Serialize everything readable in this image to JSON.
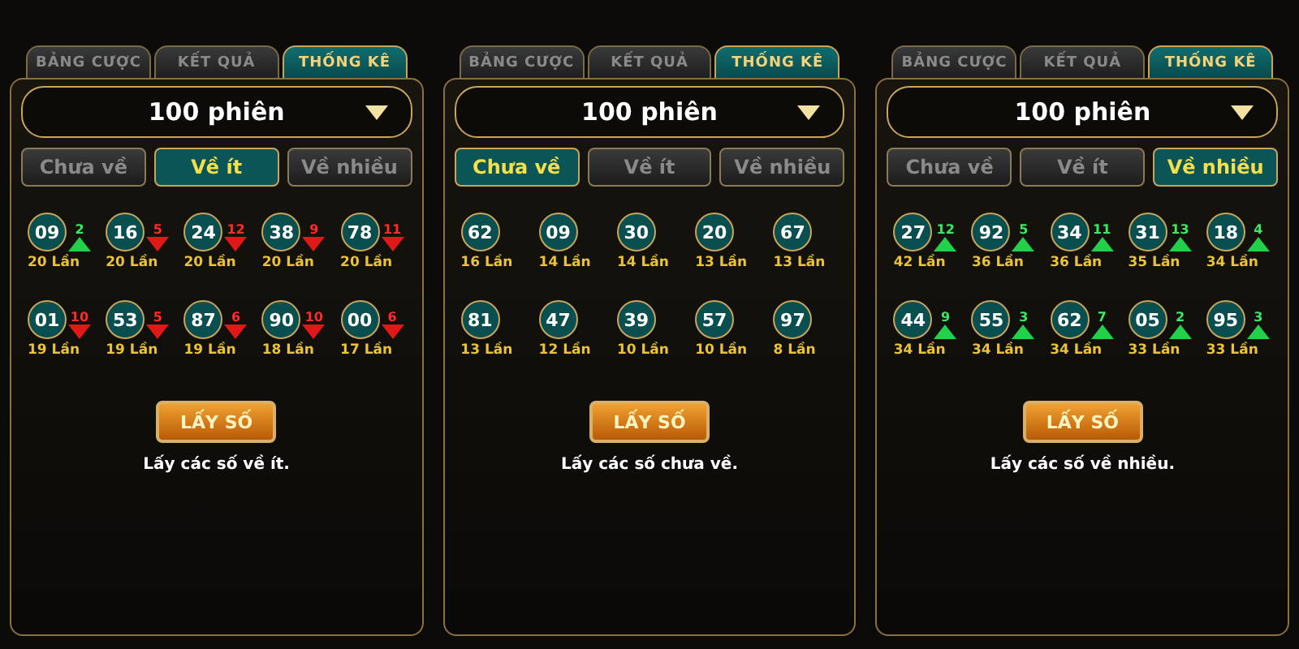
{
  "panels": [
    {
      "tabs": [
        {
          "label": "BẢNG CƯỢC",
          "selected": false
        },
        {
          "label": "KẾT QUẢ",
          "selected": false
        },
        {
          "label": "THỐNG KÊ",
          "selected": true
        }
      ],
      "dropdown": "100 phiên",
      "filters": [
        {
          "label": "Chưa về",
          "selected": false
        },
        {
          "label": "Về ít",
          "selected": true
        },
        {
          "label": "Về nhiều",
          "selected": false
        }
      ],
      "numbers": [
        {
          "number": "09",
          "count": "20 Lần",
          "kind": "up",
          "delta": "2"
        },
        {
          "number": "16",
          "count": "20 Lần",
          "kind": "down",
          "delta": "5"
        },
        {
          "number": "24",
          "count": "20 Lần",
          "kind": "down",
          "delta": "12"
        },
        {
          "number": "38",
          "count": "20 Lần",
          "kind": "down",
          "delta": "9"
        },
        {
          "number": "78",
          "count": "20 Lần",
          "kind": "down",
          "delta": "11"
        },
        {
          "number": "01",
          "count": "19 Lần",
          "kind": "down",
          "delta": "10"
        },
        {
          "number": "53",
          "count": "19 Lần",
          "kind": "down",
          "delta": "5"
        },
        {
          "number": "87",
          "count": "19 Lần",
          "kind": "down",
          "delta": "6"
        },
        {
          "number": "90",
          "count": "18 Lần",
          "kind": "down",
          "delta": "10"
        },
        {
          "number": "00",
          "count": "17 Lần",
          "kind": "down",
          "delta": "6"
        }
      ],
      "button": "LẤY SỐ",
      "caption": "Lấy các số về ít."
    },
    {
      "tabs": [
        {
          "label": "BẢNG CƯỢC",
          "selected": false
        },
        {
          "label": "KẾT QUẢ",
          "selected": false
        },
        {
          "label": "THỐNG KÊ",
          "selected": true
        }
      ],
      "dropdown": "100 phiên",
      "filters": [
        {
          "label": "Chưa về",
          "selected": true
        },
        {
          "label": "Về ít",
          "selected": false
        },
        {
          "label": "Về nhiều",
          "selected": false
        }
      ],
      "numbers": [
        {
          "number": "62",
          "count": "16 Lần"
        },
        {
          "number": "09",
          "count": "14 Lần"
        },
        {
          "number": "30",
          "count": "14 Lần"
        },
        {
          "number": "20",
          "count": "13 Lần"
        },
        {
          "number": "67",
          "count": "13 Lần"
        },
        {
          "number": "81",
          "count": "13 Lần"
        },
        {
          "number": "47",
          "count": "12 Lần"
        },
        {
          "number": "39",
          "count": "10 Lần"
        },
        {
          "number": "57",
          "count": "10 Lần"
        },
        {
          "number": "97",
          "count": "8 Lần"
        }
      ],
      "button": "LẤY SỐ",
      "caption": "Lấy các số chưa về."
    },
    {
      "tabs": [
        {
          "label": "BẢNG CƯỢC",
          "selected": false
        },
        {
          "label": "KẾT QUẢ",
          "selected": false
        },
        {
          "label": "THỐNG KÊ",
          "selected": true
        }
      ],
      "dropdown": "100 phiên",
      "filters": [
        {
          "label": "Chưa về",
          "selected": false
        },
        {
          "label": "Về ít",
          "selected": false
        },
        {
          "label": "Về nhiều",
          "selected": true
        }
      ],
      "numbers": [
        {
          "number": "27",
          "count": "42 Lần",
          "kind": "up",
          "delta": "12"
        },
        {
          "number": "92",
          "count": "36 Lần",
          "kind": "up",
          "delta": "5"
        },
        {
          "number": "34",
          "count": "36 Lần",
          "kind": "up",
          "delta": "11"
        },
        {
          "number": "31",
          "count": "35 Lần",
          "kind": "up",
          "delta": "13"
        },
        {
          "number": "18",
          "count": "34 Lần",
          "kind": "up",
          "delta": "4"
        },
        {
          "number": "44",
          "count": "34 Lần",
          "kind": "up",
          "delta": "9"
        },
        {
          "number": "55",
          "count": "34 Lần",
          "kind": "up",
          "delta": "3"
        },
        {
          "number": "62",
          "count": "34 Lần",
          "kind": "up",
          "delta": "7"
        },
        {
          "number": "05",
          "count": "33 Lần",
          "kind": "up",
          "delta": "2"
        },
        {
          "number": "95",
          "count": "33 Lần",
          "kind": "up",
          "delta": "3"
        }
      ],
      "button": "LẤY SỐ",
      "caption": "Lấy các số về nhiều."
    }
  ]
}
